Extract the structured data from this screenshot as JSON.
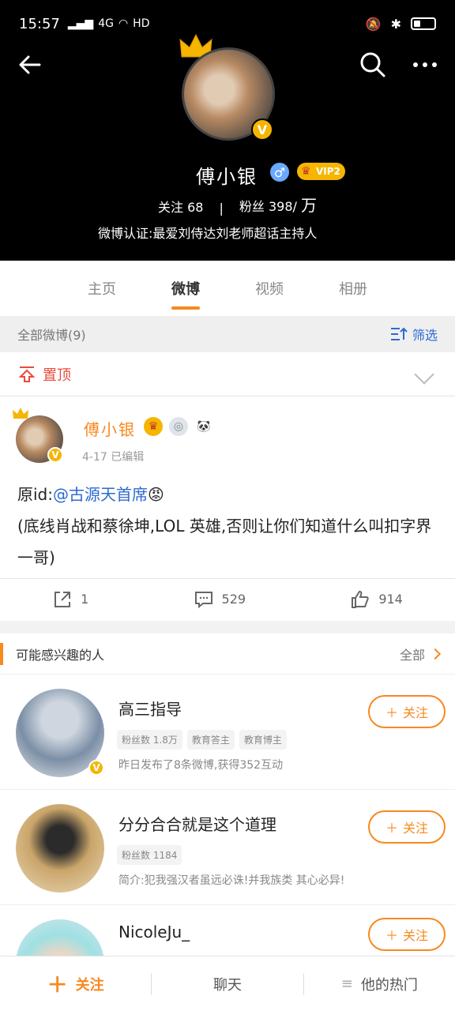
{
  "status": {
    "time": "15:57",
    "signal": "4G",
    "hd": "HD"
  },
  "profile": {
    "name": "傅小银",
    "gender_symbol": "♂",
    "vip_label": "VIP2",
    "stats": {
      "follow_label": "关注",
      "follow_value": "68",
      "fans_label": "粉丝",
      "fans_value": "398/",
      "fans_unit": "万"
    },
    "certification": "微博认证:最爱刘侍达刘老师超话主持人"
  },
  "tabs": [
    {
      "label": "主页"
    },
    {
      "label": "微博"
    },
    {
      "label": "视频"
    },
    {
      "label": "相册"
    }
  ],
  "filter": {
    "left": "全部微博(9)",
    "right": "筛选"
  },
  "pinned": {
    "label": "置顶"
  },
  "post": {
    "author": "傅小银",
    "meta": "4-17   已编辑",
    "body_prefix": "原id:",
    "mention": "@古源天首席",
    "emoji": "😡",
    "body": "(底线肖战和蔡徐坤,LOL 英雄,否则让你们知道什么叫扣字界一哥)",
    "actions": {
      "share": "1",
      "comment": "529",
      "like": "914"
    }
  },
  "interest": {
    "title": "可能感兴趣的人",
    "all": "全部",
    "people": [
      {
        "name": "高三指导",
        "tags": [
          "粉丝数 1.8万",
          "教育答主",
          "教育博主"
        ],
        "desc": "昨日发布了8条微博,获得352互动",
        "button": "关注"
      },
      {
        "name": "分分合合就是这个道理",
        "tags": [
          "粉丝数 1184"
        ],
        "desc": "简介:犯我强汉者虽远必诛!并我族类 其心必异!",
        "button": "关注"
      },
      {
        "name": "NicoleJu_",
        "tags": [],
        "desc": "",
        "button": "关注"
      }
    ]
  },
  "bottom": {
    "follow": "关注",
    "chat": "聊天",
    "hot": "他的热门"
  }
}
